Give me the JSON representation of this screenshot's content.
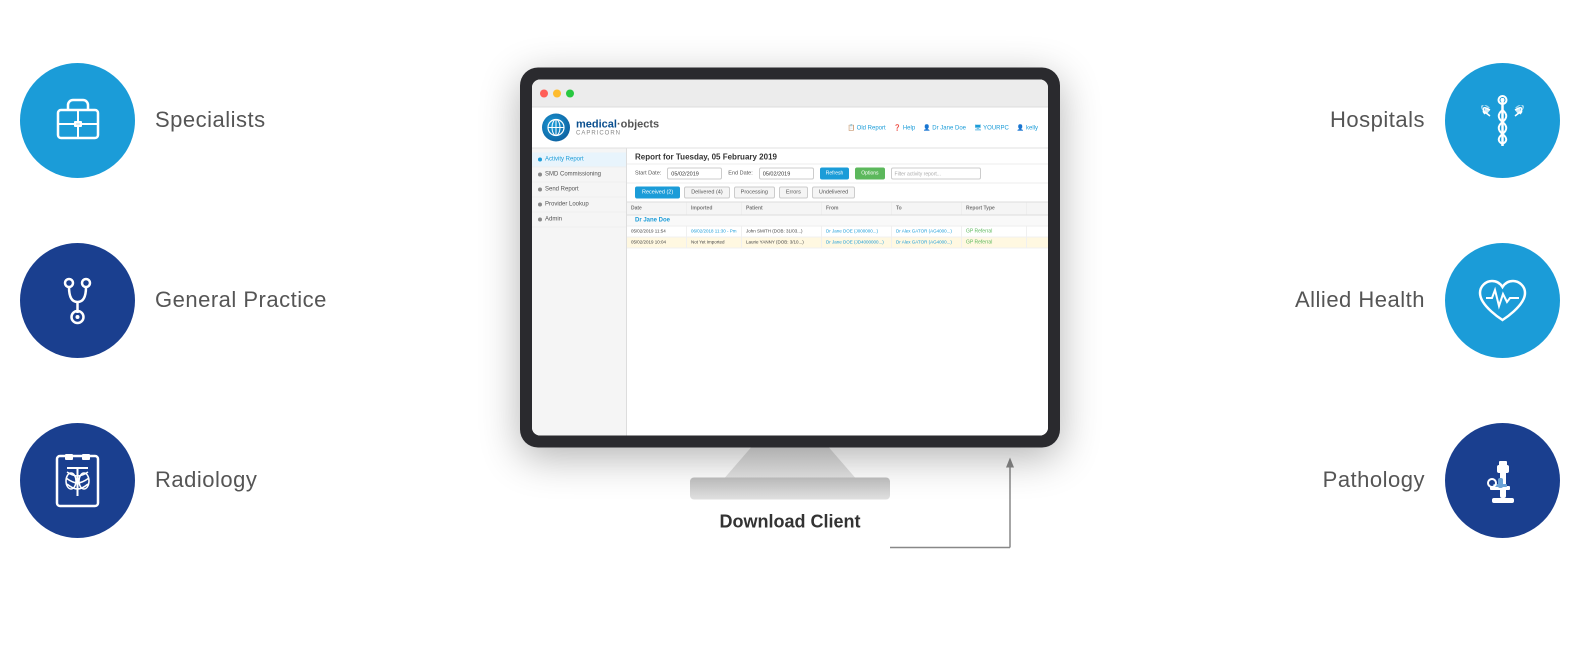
{
  "left": {
    "items": [
      {
        "id": "specialists",
        "label": "Specialists",
        "icon_type": "briefcase",
        "circle_color": "light-blue"
      },
      {
        "id": "general-practice",
        "label": "General Practice",
        "icon_type": "stethoscope",
        "circle_color": "dark-blue"
      },
      {
        "id": "radiology",
        "label": "Radiology",
        "icon_type": "xray",
        "circle_color": "dark-blue"
      }
    ]
  },
  "right": {
    "items": [
      {
        "id": "hospitals",
        "label": "Hospitals",
        "icon_type": "caduceus",
        "circle_color": "light-blue"
      },
      {
        "id": "allied-health",
        "label": "Allied Health",
        "icon_type": "heart-pulse",
        "circle_color": "light-blue"
      },
      {
        "id": "pathology",
        "label": "Pathology",
        "icon_type": "microscope",
        "circle_color": "dark-blue"
      }
    ]
  },
  "center": {
    "download_label": "Download Client",
    "monitor": {
      "topbar": {
        "dots": [
          "#ff5f57",
          "#febc2e",
          "#28c840"
        ]
      },
      "header": {
        "logo_main": "medical·objects",
        "logo_sub": "CAPRICORN",
        "actions": [
          "Old Report",
          "Help",
          "Dr Jane Doe",
          "YOURPC",
          "kelly"
        ]
      },
      "nav_items": [
        {
          "label": "Activity Report",
          "active": true
        },
        {
          "label": "SMD Commissioning"
        },
        {
          "label": "Send Report"
        },
        {
          "label": "Provider Lookup"
        },
        {
          "label": "Admin"
        }
      ],
      "content_title": "Report for Tuesday, 05 February 2019",
      "filter": {
        "start_label": "Start Date:",
        "start_value": "05/02/2019",
        "end_label": "End Date:",
        "end_value": "05/02/2019",
        "refresh_btn": "Refresh",
        "options_btn": "Options",
        "search_placeholder": "Filter activity report..."
      },
      "tabs": [
        {
          "label": "Received (2)",
          "active": true
        },
        {
          "label": "Delivered (4)"
        },
        {
          "label": "Processing"
        },
        {
          "label": "Errors"
        },
        {
          "label": "Undelivered"
        }
      ],
      "table": {
        "headers": [
          "Date",
          "Imported",
          "Patient",
          "From",
          "To",
          "Report Type"
        ],
        "group": "Dr Jane Doe",
        "rows": [
          {
            "date": "05/02/2019 11:54",
            "imported": "06/02/2018 11:30 - Pm",
            "patient": "John SMITH (DOB: 31/03...)",
            "from": "Dr Jane DOE (J000000...)",
            "to": "Dr Alex GATOR (AG4000...)",
            "report_type": "GP Referral",
            "highlighted": false
          },
          {
            "date": "05/02/2019 10:04",
            "imported": "Not Yet Imported",
            "patient": "Laurie YANNY (DOB: 3/10...)",
            "from": "Dr Jane DOE (JD4000000...)",
            "to": "Dr Alex GATOR (AG4000...)",
            "report_type": "GP Referral",
            "highlighted": true
          }
        ]
      }
    }
  }
}
